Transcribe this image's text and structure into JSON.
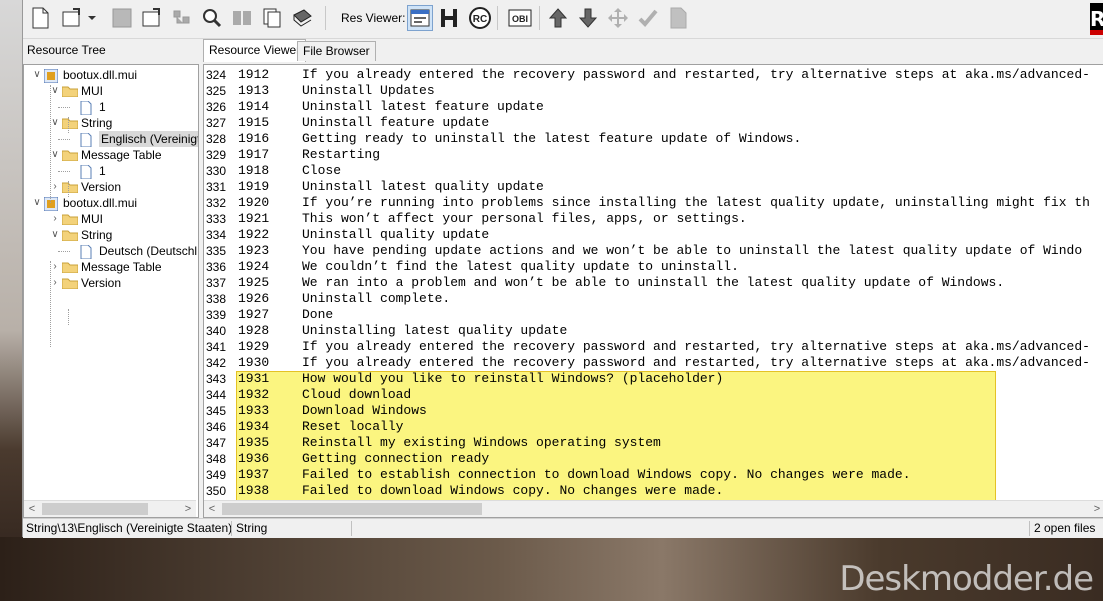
{
  "toolbar": {
    "res_viewer_label": "Res Viewer:"
  },
  "left_panel": {
    "header": "Resource Tree",
    "tree": [
      {
        "label": "bootux.dll.mui",
        "depth": 0,
        "expanded": true,
        "icon": "dll-icon"
      },
      {
        "label": "MUI",
        "depth": 1,
        "expanded": true,
        "icon": "folder-icon"
      },
      {
        "label": "1",
        "depth": 2,
        "icon": "file-icon"
      },
      {
        "label": "String",
        "depth": 1,
        "expanded": true,
        "icon": "folder-icon"
      },
      {
        "label": "Englisch (Vereinigte",
        "depth": 2,
        "icon": "file-icon",
        "selected": true
      },
      {
        "label": "Message Table",
        "depth": 1,
        "expanded": true,
        "icon": "folder-icon"
      },
      {
        "label": "1",
        "depth": 2,
        "icon": "file-icon"
      },
      {
        "label": "Version",
        "depth": 1,
        "expanded": false,
        "icon": "folder-icon"
      },
      {
        "label": "bootux.dll.mui",
        "depth": 0,
        "expanded": true,
        "icon": "dll-icon"
      },
      {
        "label": "MUI",
        "depth": 1,
        "expanded": false,
        "icon": "folder-icon"
      },
      {
        "label": "String",
        "depth": 1,
        "expanded": true,
        "icon": "folder-icon"
      },
      {
        "label": "Deutsch (Deutschl",
        "depth": 2,
        "icon": "file-icon"
      },
      {
        "label": "Message Table",
        "depth": 1,
        "expanded": false,
        "icon": "folder-icon"
      },
      {
        "label": "Version",
        "depth": 1,
        "expanded": false,
        "icon": "folder-icon"
      }
    ]
  },
  "tabs": [
    {
      "label": "Resource Viewer",
      "active": true
    },
    {
      "label": "File Browser",
      "active": false
    }
  ],
  "code_lines": [
    {
      "ln": "324",
      "id": "1912",
      "text": "If you already entered the recovery password and restarted, try alternative steps at aka.ms/advanced-"
    },
    {
      "ln": "325",
      "id": "1913",
      "text": "Uninstall Updates"
    },
    {
      "ln": "326",
      "id": "1914",
      "text": "Uninstall latest feature update"
    },
    {
      "ln": "327",
      "id": "1915",
      "text": "Uninstall feature update"
    },
    {
      "ln": "328",
      "id": "1916",
      "text": "Getting ready to uninstall the latest feature update of Windows."
    },
    {
      "ln": "329",
      "id": "1917",
      "text": "Restarting"
    },
    {
      "ln": "330",
      "id": "1918",
      "text": "Close"
    },
    {
      "ln": "331",
      "id": "1919",
      "text": "Uninstall latest quality update"
    },
    {
      "ln": "332",
      "id": "1920",
      "text": "If you’re running into problems since installing the latest quality update, uninstalling might fix th"
    },
    {
      "ln": "333",
      "id": "1921",
      "text": "This won’t affect your personal files, apps, or settings."
    },
    {
      "ln": "334",
      "id": "1922",
      "text": "Uninstall quality update"
    },
    {
      "ln": "335",
      "id": "1923",
      "text": "You have pending update actions and we won’t be able to uninstall the latest quality update of Windo"
    },
    {
      "ln": "336",
      "id": "1924",
      "text": "We couldn’t find the latest quality update to uninstall."
    },
    {
      "ln": "337",
      "id": "1925",
      "text": "We ran into a problem and won’t be able to uninstall the latest quality update of Windows."
    },
    {
      "ln": "338",
      "id": "1926",
      "text": "Uninstall complete."
    },
    {
      "ln": "339",
      "id": "1927",
      "text": "Done"
    },
    {
      "ln": "340",
      "id": "1928",
      "text": "Uninstalling latest quality update"
    },
    {
      "ln": "341",
      "id": "1929",
      "text": "If you already entered the recovery password and restarted, try alternative steps at aka.ms/advanced-"
    },
    {
      "ln": "342",
      "id": "1930",
      "text": "If you already entered the recovery password and restarted, try alternative steps at aka.ms/advanced-"
    },
    {
      "ln": "343",
      "id": "1931",
      "text": "How would you like to reinstall Windows? (placeholder)"
    },
    {
      "ln": "344",
      "id": "1932",
      "text": "Cloud download"
    },
    {
      "ln": "345",
      "id": "1933",
      "text": "Download Windows"
    },
    {
      "ln": "346",
      "id": "1934",
      "text": "Reset locally"
    },
    {
      "ln": "347",
      "id": "1935",
      "text": "Reinstall my existing Windows operating system"
    },
    {
      "ln": "348",
      "id": "1936",
      "text": "Getting connection ready"
    },
    {
      "ln": "349",
      "id": "1937",
      "text": "Failed to establish connection to download Windows copy. No changes were made."
    },
    {
      "ln": "350",
      "id": "1938",
      "text": "Failed to download Windows copy. No changes were made."
    }
  ],
  "status": {
    "path": "String\\13\\Englisch (Vereinigte Staaten)",
    "type": "String",
    "open_files": "2 open files"
  },
  "colors": {
    "highlight": "#fbf46a",
    "highlight_border": "#e0b800",
    "selection": "#d9d9d9"
  },
  "watermark": "Deskmodder.de",
  "logo_text": "R"
}
